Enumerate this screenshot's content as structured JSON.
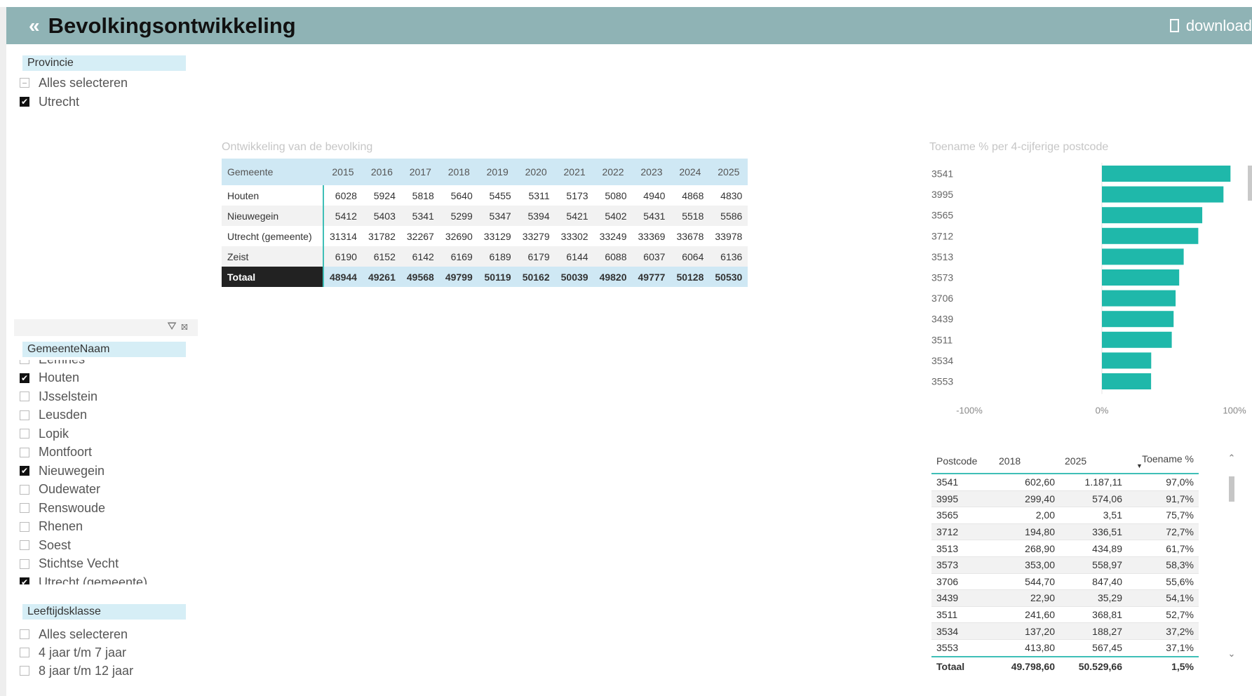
{
  "header": {
    "back_icon": "«",
    "title": "Bevolkingsontwikkeling",
    "download_label": "download"
  },
  "slicers": {
    "provincie": {
      "title": "Provincie",
      "items": [
        {
          "label": "Alles selecteren",
          "state": "partial"
        },
        {
          "label": "Utrecht",
          "state": "checked"
        }
      ]
    },
    "gemeente": {
      "title": "GemeenteNaam",
      "items": [
        {
          "label": "Eemnes",
          "state": "unchecked"
        },
        {
          "label": "Houten",
          "state": "checked"
        },
        {
          "label": "IJsselstein",
          "state": "unchecked"
        },
        {
          "label": "Leusden",
          "state": "unchecked"
        },
        {
          "label": "Lopik",
          "state": "unchecked"
        },
        {
          "label": "Montfoort",
          "state": "unchecked"
        },
        {
          "label": "Nieuwegein",
          "state": "checked"
        },
        {
          "label": "Oudewater",
          "state": "unchecked"
        },
        {
          "label": "Renswoude",
          "state": "unchecked"
        },
        {
          "label": "Rhenen",
          "state": "unchecked"
        },
        {
          "label": "Soest",
          "state": "unchecked"
        },
        {
          "label": "Stichtse Vecht",
          "state": "unchecked"
        },
        {
          "label": "Utrecht (gemeente)",
          "state": "checked"
        }
      ]
    },
    "leeftijd": {
      "title": "Leeftijdsklasse",
      "items": [
        {
          "label": "Alles selecteren",
          "state": "unchecked"
        },
        {
          "label": "4 jaar t/m 7 jaar",
          "state": "unchecked"
        },
        {
          "label": "8 jaar t/m 12 jaar",
          "state": "unchecked"
        }
      ]
    }
  },
  "population_table": {
    "title": "Ontwikkeling van de bevolking",
    "columns": [
      "Gemeente",
      "2015",
      "2016",
      "2017",
      "2018",
      "2019",
      "2020",
      "2021",
      "2022",
      "2023",
      "2024",
      "2025"
    ],
    "rows": [
      [
        "Houten",
        "6028",
        "5924",
        "5818",
        "5640",
        "5455",
        "5311",
        "5173",
        "5080",
        "4940",
        "4868",
        "4830"
      ],
      [
        "Nieuwegein",
        "5412",
        "5403",
        "5341",
        "5299",
        "5347",
        "5394",
        "5421",
        "5402",
        "5431",
        "5518",
        "5586"
      ],
      [
        "Utrecht (gemeente)",
        "31314",
        "31782",
        "32267",
        "32690",
        "33129",
        "33279",
        "33302",
        "33249",
        "33369",
        "33678",
        "33978"
      ],
      [
        "Zeist",
        "6190",
        "6152",
        "6142",
        "6169",
        "6189",
        "6179",
        "6144",
        "6088",
        "6037",
        "6064",
        "6136"
      ]
    ],
    "total": [
      "Totaal",
      "48944",
      "49261",
      "49568",
      "49799",
      "50119",
      "50162",
      "50039",
      "49820",
      "49777",
      "50128",
      "50530"
    ]
  },
  "chart_data": {
    "type": "bar",
    "orientation": "horizontal",
    "title": "Toename % per 4-cijferige postcode",
    "categories": [
      "3541",
      "3995",
      "3565",
      "3712",
      "3513",
      "3573",
      "3706",
      "3439",
      "3511",
      "3534",
      "3553"
    ],
    "values": [
      97.0,
      91.7,
      75.7,
      72.7,
      61.7,
      58.3,
      55.6,
      54.1,
      52.7,
      37.2,
      37.1
    ],
    "xlim": [
      -100,
      100
    ],
    "x_ticks": [
      "-100%",
      "0%",
      "100%"
    ],
    "color": "#1fb8aa",
    "grid": false
  },
  "postcode_table": {
    "columns": [
      "Postcode",
      "2018",
      "2025",
      "Toename %"
    ],
    "sort_icon": "▼",
    "rows": [
      [
        "3541",
        "602,60",
        "1.187,11",
        "97,0%"
      ],
      [
        "3995",
        "299,40",
        "574,06",
        "91,7%"
      ],
      [
        "3565",
        "2,00",
        "3,51",
        "75,7%"
      ],
      [
        "3712",
        "194,80",
        "336,51",
        "72,7%"
      ],
      [
        "3513",
        "268,90",
        "434,89",
        "61,7%"
      ],
      [
        "3573",
        "353,00",
        "558,97",
        "58,3%"
      ],
      [
        "3706",
        "544,70",
        "847,40",
        "55,6%"
      ],
      [
        "3439",
        "22,90",
        "35,29",
        "54,1%"
      ],
      [
        "3511",
        "241,60",
        "368,81",
        "52,7%"
      ],
      [
        "3534",
        "137,20",
        "188,27",
        "37,2%"
      ],
      [
        "3553",
        "413,80",
        "567,45",
        "37,1%"
      ]
    ],
    "total": [
      "Totaal",
      "49.798,60",
      "50.529,66",
      "1,5%"
    ]
  }
}
